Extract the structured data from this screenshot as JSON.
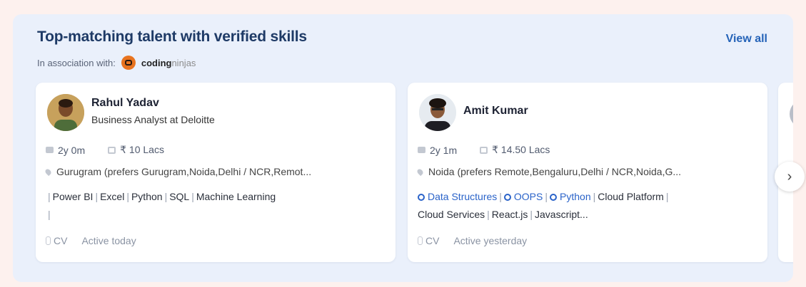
{
  "section": {
    "title": "Top-matching talent with verified skills",
    "association_label": "In association with:",
    "brand_bold": "coding",
    "brand_light": "ninjas",
    "view_all": "View all"
  },
  "cards": [
    {
      "name": "Rahul Yadav",
      "role": "Business Analyst at Deloitte",
      "experience": "2y 0m",
      "salary": "₹ 10 Lacs",
      "location": "Gurugram (prefers Gurugram,Noida,Delhi / NCR,Remot...",
      "skills": [
        "Power BI",
        "Excel",
        "Python",
        "SQL",
        "Machine Learning"
      ],
      "cv_label": "CV",
      "activity": "Active today"
    },
    {
      "name": "Amit Kumar",
      "experience": "2y 1m",
      "salary": "₹ 14.50 Lacs",
      "location": "Noida (prefers Remote,Bengaluru,Delhi / NCR,Noida,G...",
      "verified_skills": [
        "Data Structures",
        "OOPS",
        "Python"
      ],
      "skills": [
        "Cloud Platform",
        "Cloud Services",
        "React.js",
        "Javascript..."
      ],
      "cv_label": "CV",
      "activity": "Active yesterday"
    }
  ],
  "icons": {
    "next": "chevron-right-icon",
    "experience": "briefcase-icon",
    "salary": "wallet-icon",
    "location": "map-pin-icon",
    "verified": "badge-icon",
    "cv": "paperclip-icon"
  },
  "colors": {
    "accent": "#2563b8",
    "verified_skill": "#2a63c9",
    "panel_bg": "#eaf0fb",
    "page_bg": "#fdf1ee"
  }
}
